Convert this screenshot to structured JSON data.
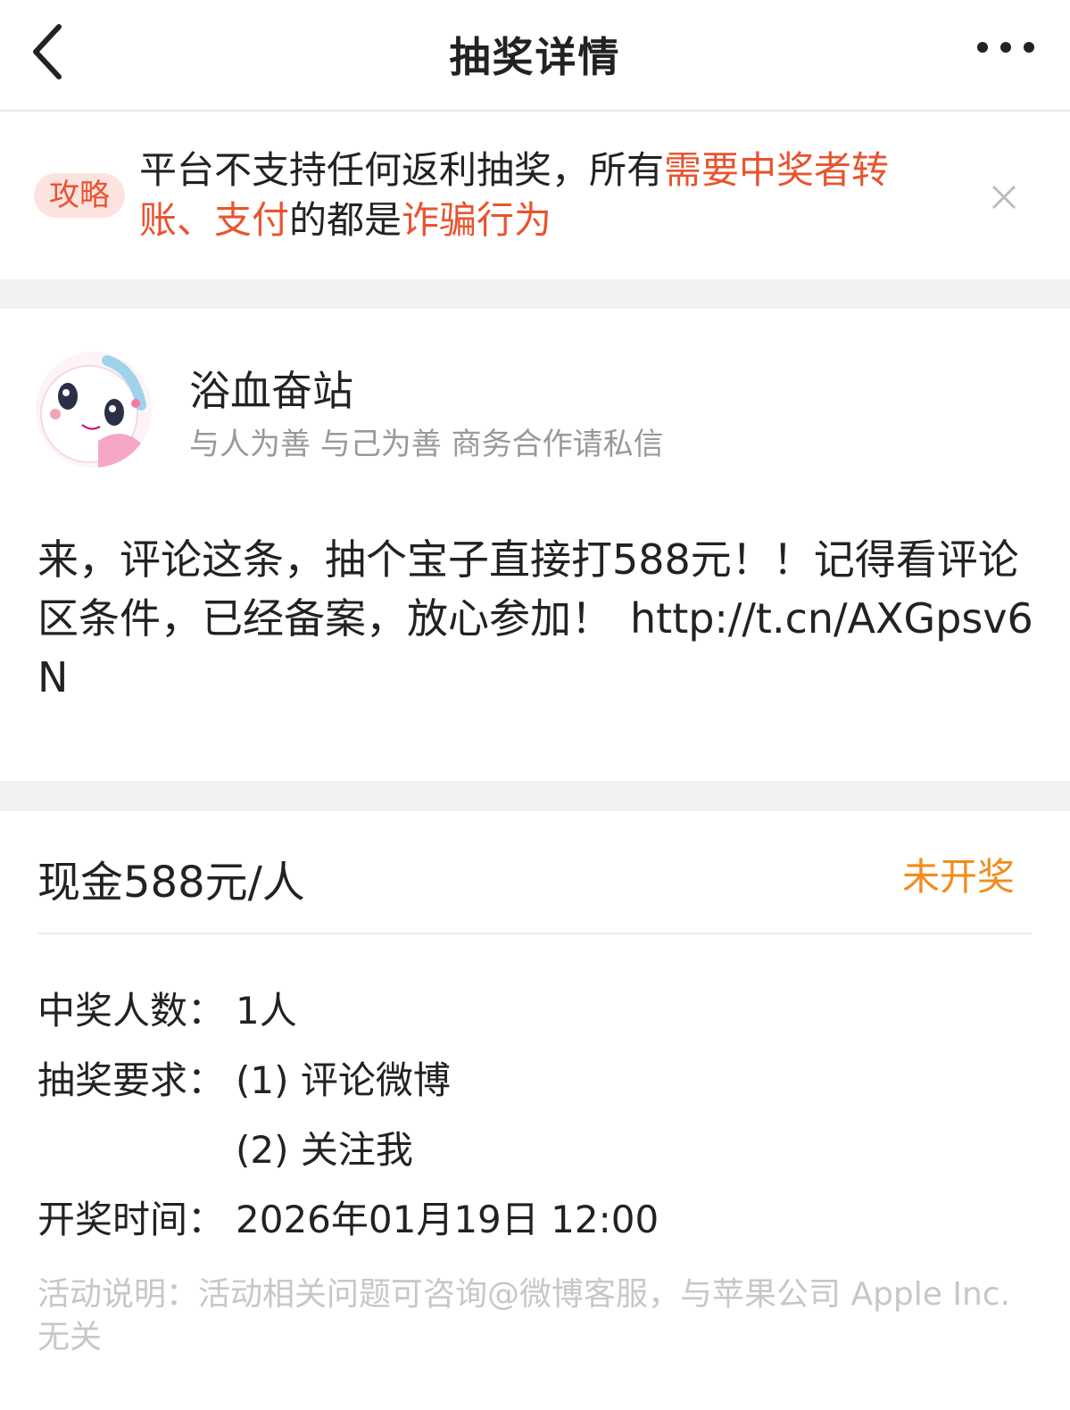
{
  "header": {
    "title": "抽奖详情"
  },
  "notice": {
    "badge": "攻略",
    "text_1": "平台不支持任何返利抽奖，所有",
    "text_red_1": "需要中奖者转账、支付",
    "text_2": "的都是",
    "text_red_2": "诈骗行为"
  },
  "post": {
    "author_name": "浴血奋站",
    "author_bio": "与人为善 与己为善 商务合作请私信",
    "body": "来，评论这条，抽个宝子直接打588元！！记得看评论区条件，已经备案，放心参加！",
    "link": "http://t.cn/AXGpsv6N"
  },
  "lottery": {
    "prize": "现金588元/人",
    "status": "未开奖",
    "winners_label": "中奖人数：",
    "winners_value": "1人",
    "requirement_label": "抽奖要求：",
    "requirements": [
      "(1) 评论微博",
      "(2) 关注我"
    ],
    "time_label": "开奖时间：",
    "time_value": "2026年01月19日 12:00",
    "footnote": "活动说明：活动相关问题可咨询@微博客服，与苹果公司 Apple Inc. 无关"
  },
  "colors": {
    "accent_red": "#e8542f",
    "status_orange": "#f28c1b",
    "muted": "#999999"
  },
  "icons": [
    "back-arrow-icon",
    "more-dots-icon",
    "close-icon"
  ]
}
